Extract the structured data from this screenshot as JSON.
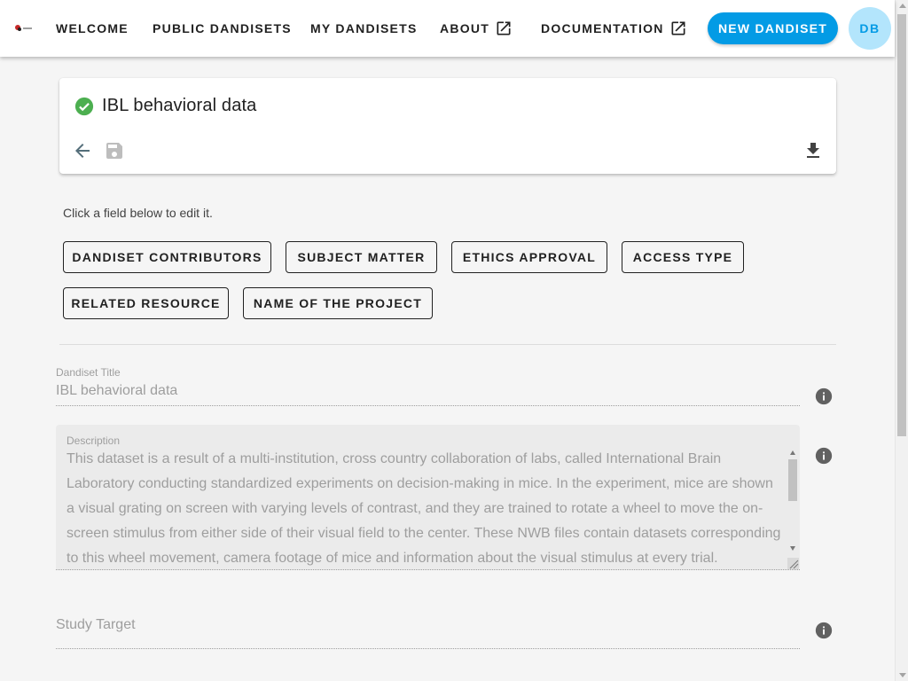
{
  "nav": {
    "welcome": "WELCOME",
    "public": "PUBLIC DANDISETS",
    "mine": "MY DANDISETS",
    "about": "ABOUT",
    "docs": "DOCUMENTATION",
    "new_button": "NEW DANDISET",
    "avatar_initials": "DB"
  },
  "card": {
    "title": "IBL behavioral data",
    "status_icon": "check-circle-icon",
    "actions": [
      "arrow-left-icon",
      "save-icon",
      "download-icon"
    ]
  },
  "hint": "Click a field below to edit it.",
  "sections": [
    "DANDISET CONTRIBUTORS",
    "SUBJECT MATTER",
    "ETHICS APPROVAL",
    "ACCESS TYPE",
    "RELATED RESOURCE",
    "NAME OF THE PROJECT"
  ],
  "fields": {
    "title_label": "Dandiset Title",
    "title_value": "IBL behavioral data",
    "description_label": "Description",
    "description_value": "This dataset is a result of a multi-institution, cross country collaboration of labs, called International Brain Laboratory conducting standardized experiments on decision-making in mice. In the experiment, mice are shown a visual grating on screen with varying levels of contrast, and they are trained to rotate a wheel to move the on-screen stimulus from either side of their visual field to the center. These NWB files contain datasets corresponding to this wheel movement, camera footage of mice and information about the visual stimulus at every trial.",
    "study_target_placeholder": "Study Target"
  },
  "colors": {
    "accent": "#039be5",
    "avatar_bg": "#b3e5fc",
    "success": "#4caf50",
    "icon_grey": "#546e7a"
  }
}
